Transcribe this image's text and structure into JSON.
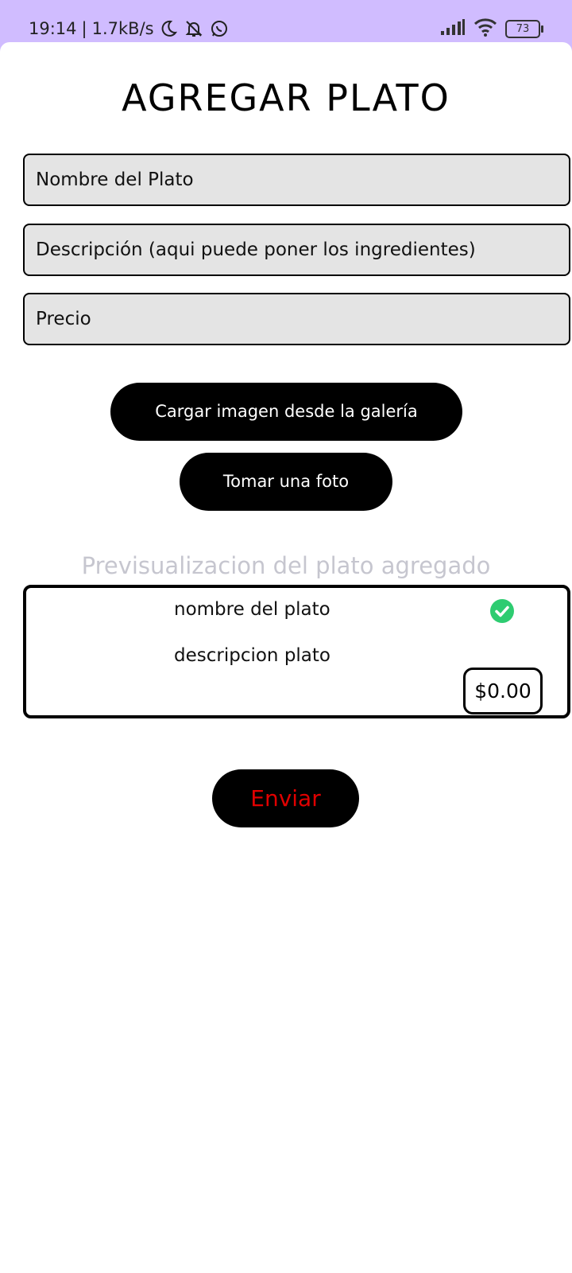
{
  "status_bar": {
    "time": "19:14",
    "separator": "|",
    "network_speed": "1.7kB/s",
    "battery_level": "73",
    "icons": [
      "moon-icon",
      "notifications-off-icon",
      "whatsapp-icon",
      "signal-icon",
      "wifi-icon",
      "battery-icon"
    ]
  },
  "page": {
    "title": "AGREGAR PLATO"
  },
  "form": {
    "name_placeholder": "Nombre del Plato",
    "description_placeholder": "Descripción (aqui puede poner los ingredientes)",
    "price_placeholder": "Precio"
  },
  "actions": {
    "gallery_label": "Cargar imagen desde la galería",
    "photo_label": "Tomar una foto",
    "send_label": "Enviar"
  },
  "preview": {
    "label": "Previsualizacion del plato agregado",
    "name": "nombre del plato",
    "description": "descripcion plato",
    "price": "$0.00",
    "check_icon": "check-circle-icon"
  },
  "colors": {
    "status_bar_bg": "#d0bcff",
    "field_bg": "#e4e4e4",
    "button_bg": "#000000",
    "send_text": "#e00000",
    "preview_label": "#c6c6cf",
    "check_green": "#2ecc71"
  }
}
